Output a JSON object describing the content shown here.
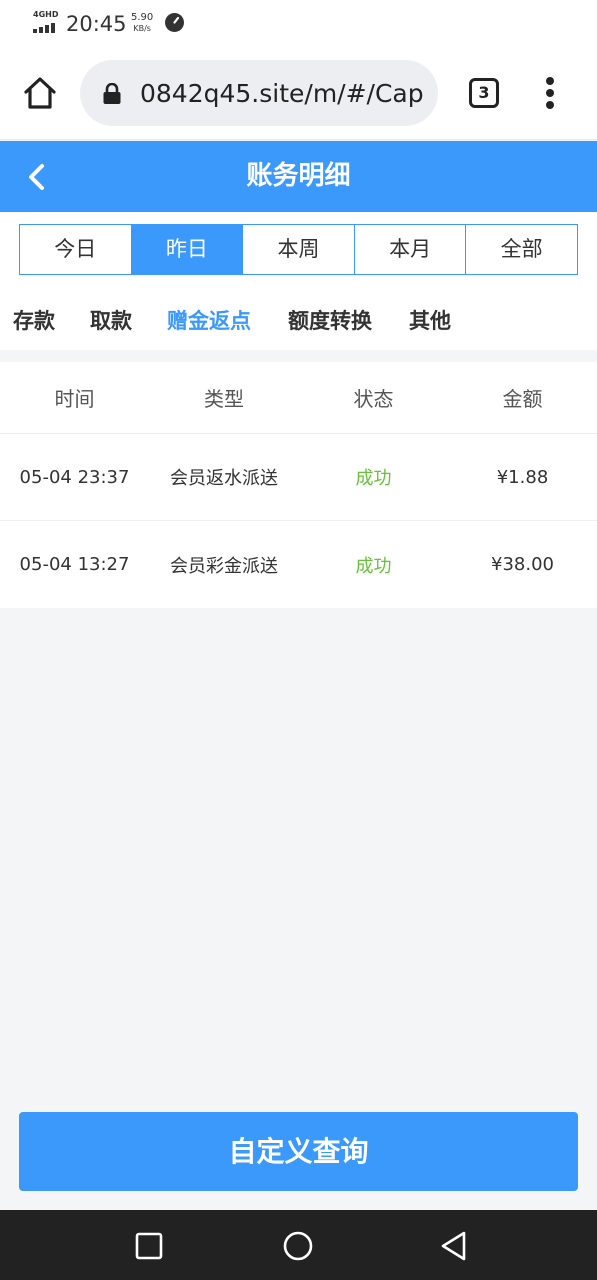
{
  "status_bar": {
    "network": "4GHD",
    "time": "20:45",
    "speed_value": "5.90",
    "speed_unit": "KB/s"
  },
  "browser": {
    "url": "0842q45.site/m/#/Cap",
    "tab_count": "3",
    "icons": [
      "home-icon",
      "lock-icon",
      "tabs-icon",
      "more-vert-icon"
    ]
  },
  "header": {
    "title": "账务明细",
    "back_icon": "chevron-left-icon"
  },
  "period_tabs": [
    {
      "label": "今日",
      "active": false
    },
    {
      "label": "昨日",
      "active": true
    },
    {
      "label": "本周",
      "active": false
    },
    {
      "label": "本月",
      "active": false
    },
    {
      "label": "全部",
      "active": false
    }
  ],
  "category_tabs": [
    {
      "label": "存款",
      "active": false
    },
    {
      "label": "取款",
      "active": false
    },
    {
      "label": "赠金返点",
      "active": true
    },
    {
      "label": "额度转换",
      "active": false
    },
    {
      "label": "其他",
      "active": false
    }
  ],
  "table": {
    "headers": [
      "时间",
      "类型",
      "状态",
      "金额"
    ],
    "rows": [
      {
        "time": "05-04 23:37",
        "type": "会员返水派送",
        "status": "成功",
        "amount": "¥1.88"
      },
      {
        "time": "05-04 13:27",
        "type": "会员彩金派送",
        "status": "成功",
        "amount": "¥38.00"
      }
    ]
  },
  "query_button": {
    "label": "自定义查询"
  },
  "nav_bar": {
    "icons": [
      "recents-square-icon",
      "home-circle-icon",
      "back-triangle-icon"
    ]
  },
  "colors": {
    "accent": "#3b99fc",
    "success": "#67c23a",
    "background": "#f4f5f7"
  }
}
